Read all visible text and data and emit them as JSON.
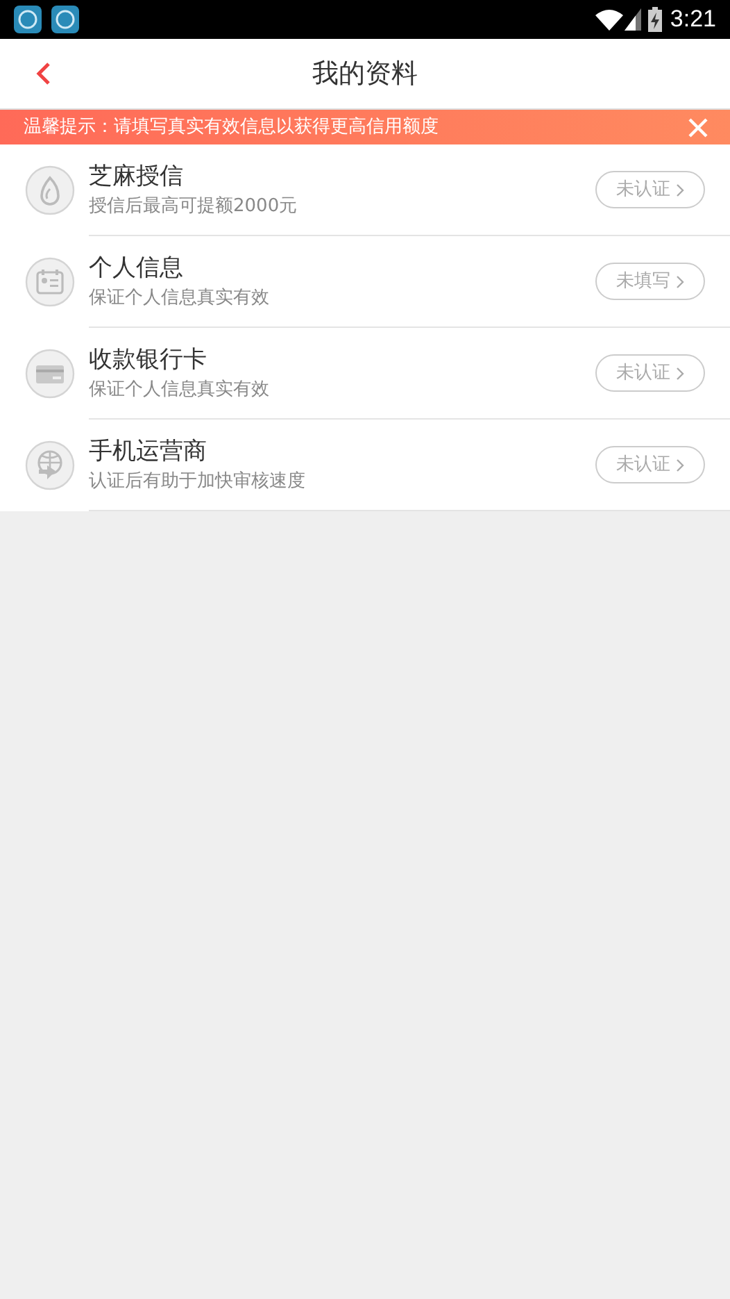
{
  "status_bar": {
    "time": "3:21"
  },
  "header": {
    "title": "我的资料"
  },
  "notice": {
    "text": "温馨提示：请填写真实有效信息以获得更高信用额度"
  },
  "items": [
    {
      "kind": "sesame",
      "title": "芝麻授信",
      "subtitle": "授信后最高可提额2000元",
      "status": "未认证"
    },
    {
      "kind": "id",
      "title": "个人信息",
      "subtitle": "保证个人信息真实有效",
      "status": "未填写"
    },
    {
      "kind": "card",
      "title": "收款银行卡",
      "subtitle": "保证个人信息真实有效",
      "status": "未认证"
    },
    {
      "kind": "carrier",
      "title": "手机运营商",
      "subtitle": "认证后有助于加快审核速度",
      "status": "未认证"
    }
  ]
}
